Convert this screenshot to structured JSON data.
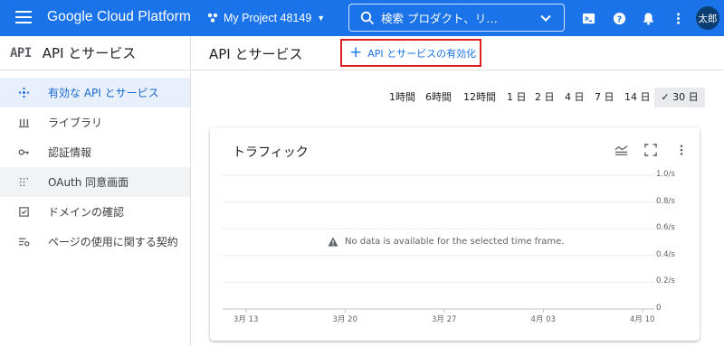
{
  "header": {
    "product_name": "Google Cloud Platform",
    "project_name": "My Project 48149",
    "search_text": "検索  プロダクト、リ…",
    "avatar_text": "太郎",
    "icons": [
      "menu-icon",
      "project-icon",
      "search-icon",
      "cloud-shell-icon",
      "help-icon",
      "notifications-icon",
      "more-vert-icon"
    ]
  },
  "sidebar": {
    "logo": "API",
    "title": "API とサービス",
    "items": [
      {
        "label": "有効な API とサービス",
        "icon": "dashboard-icon"
      },
      {
        "label": "ライブラリ",
        "icon": "library-icon"
      },
      {
        "label": "認証情報",
        "icon": "key-icon"
      },
      {
        "label": "OAuth 同意画面",
        "icon": "consent-icon"
      },
      {
        "label": "ドメインの確認",
        "icon": "checkbox-icon"
      },
      {
        "label": "ページの使用に関する契約",
        "icon": "settings-list-icon"
      }
    ]
  },
  "main": {
    "title": "API とサービス",
    "enable_button": "API とサービスの有効化",
    "time_ranges": [
      "1時間",
      "6時間",
      "12時間",
      "1 日",
      "2 日",
      "4 日",
      "7 日",
      "14 日",
      "30 日"
    ],
    "selected_range": "30 日"
  },
  "card": {
    "title": "トラフィック",
    "no_data": "No data is available for the selected time frame."
  },
  "chart_data": {
    "type": "line",
    "title": "トラフィック",
    "series": [],
    "x": [
      "3月 13",
      "3月 20",
      "3月 27",
      "4月 03",
      "4月 10"
    ],
    "y_ticks": [
      "1.0/s",
      "0.8/s",
      "0.6/s",
      "0.4/s",
      "0.2/s",
      "0"
    ],
    "ylim": [
      0,
      1.0
    ],
    "grid": true
  },
  "colors": {
    "brand_blue": "#1a73e8",
    "highlight_red": "#e02020",
    "active_bg": "#e8f0fe"
  }
}
